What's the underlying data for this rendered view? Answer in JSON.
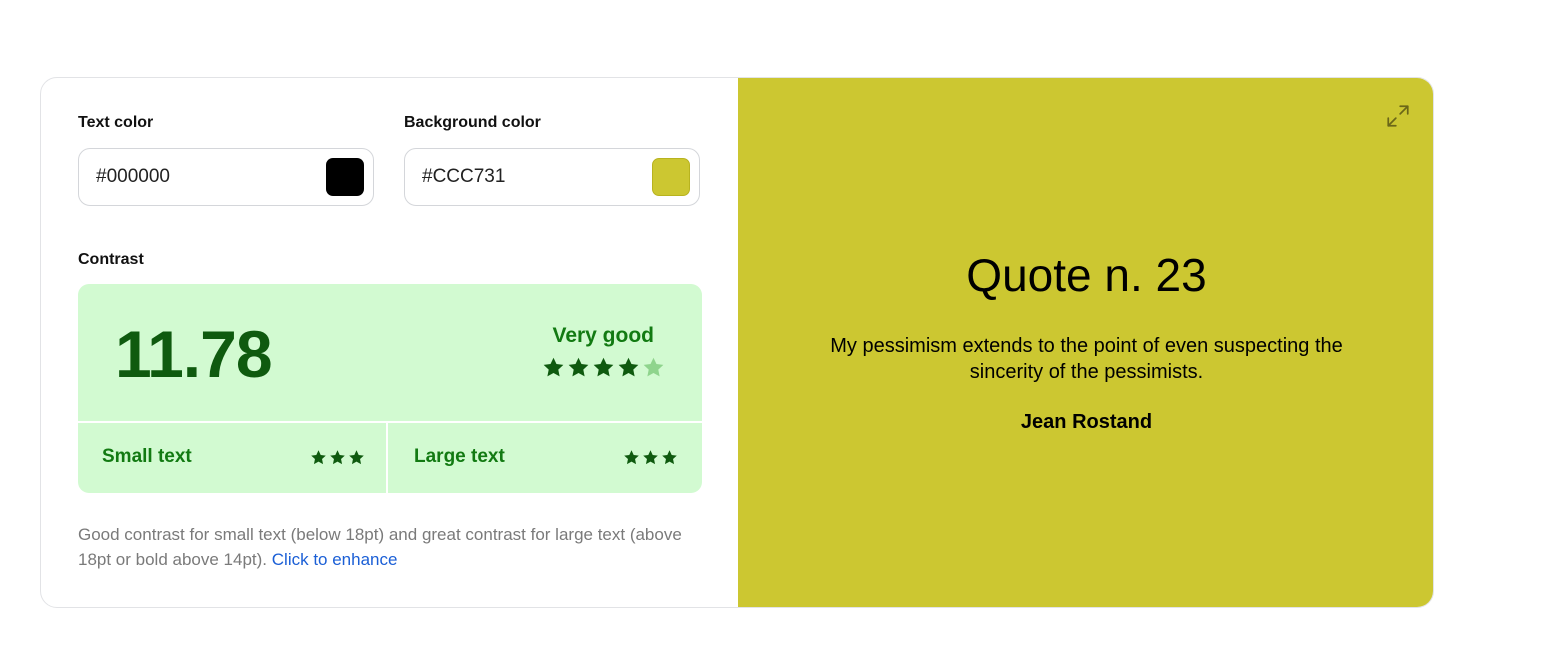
{
  "text_color": {
    "label": "Text color",
    "value": "#000000",
    "swatch": "#000000"
  },
  "background_color": {
    "label": "Background color",
    "value": "#CCC731",
    "swatch": "#CCC731"
  },
  "contrast": {
    "label": "Contrast",
    "ratio": "11.78",
    "rating": "Very good",
    "stars_filled": 4,
    "stars_total": 5,
    "small_text": {
      "label": "Small text",
      "stars": 3
    },
    "large_text": {
      "label": "Large text",
      "stars": 3
    },
    "colors": {
      "panel": "#D2FAD1",
      "star_filled": "#0F5A0F",
      "star_empty": "#8FD48D"
    }
  },
  "description": {
    "text": "Good contrast for small text (below 18pt) and great contrast for large text (above 18pt or bold above 14pt).",
    "link": "Click to enhance"
  },
  "preview": {
    "background": "#CCC731",
    "title": "Quote n. 23",
    "quote": "My pessimism extends to the point of even suspecting the sincerity of the pessimists.",
    "author": "Jean Rostand",
    "expand_icon": "expand-icon"
  }
}
